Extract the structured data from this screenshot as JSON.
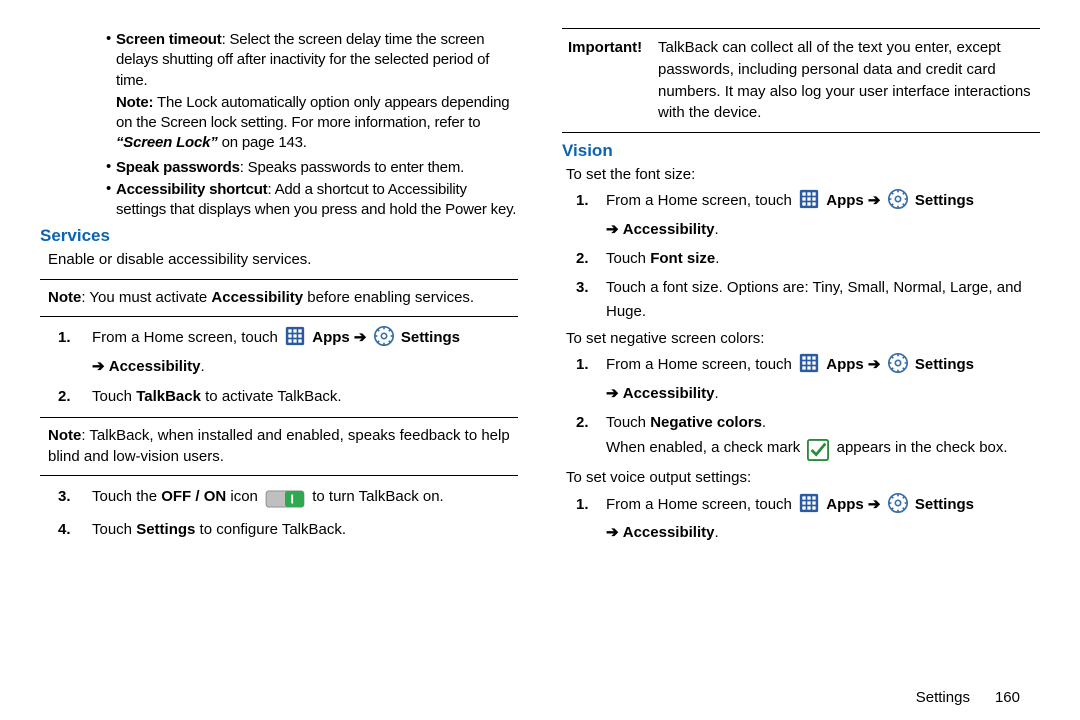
{
  "left": {
    "bullets": [
      {
        "term": "Screen timeout",
        "rest": ": Select the screen delay time the screen delays shutting off after inactivity for the selected period of time."
      },
      {
        "term": "Speak passwords",
        "rest": ": Speaks passwords to enter them."
      },
      {
        "term": "Accessibility shortcut",
        "rest": ": Add a shortcut to Accessibility settings that displays when you press and hold the Power key."
      }
    ],
    "note1_lead": "Note:",
    "note1_rest": " The Lock automatically option only appears depending on the Screen lock setting. For more information, refer to ",
    "note1_ref": "“Screen Lock”",
    "note1_tail": " on page 143.",
    "services_heading": "Services",
    "services_para": "Enable or disable accessibility services.",
    "services_note_lead": "Note",
    "services_note_rest": ": You must activate ",
    "services_note_bold": "Accessibility",
    "services_note_tail": " before enabling services.",
    "step1_pre": "From a Home screen, touch ",
    "apps_label": "Apps",
    "arrow": "➔",
    "settings_label": "Settings",
    "accessibility_label": "Accessibility",
    "step2_pre": "Touch ",
    "step2_bold": "TalkBack",
    "step2_post": " to activate TalkBack.",
    "tb_note_lead": "Note",
    "tb_note_rest": ": TalkBack, when installed and enabled, speaks feedback to help blind and low-vision users.",
    "step3_pre": "Touch the ",
    "step3_bold": "OFF / ON",
    "step3_mid": " icon ",
    "step3_post": " to turn TalkBack on.",
    "step4_pre": "Touch ",
    "step4_bold": "Settings",
    "step4_post": " to configure TalkBack."
  },
  "right": {
    "important_lead": "Important!",
    "important_rest": " TalkBack can collect all of the text you enter, except passwords, including personal data and credit card numbers. It may also log your user interface interactions with the device.",
    "vision_heading": "Vision",
    "font_intro": "To set the font size:",
    "step1_pre": "From a Home screen, touch ",
    "apps_label": "Apps",
    "arrow": "➔",
    "settings_label": "Settings",
    "accessibility_label": "Accessibility",
    "font_step2_pre": "Touch ",
    "font_step2_bold": "Font size",
    "font_step3": "Touch a font size. Options are: Tiny, Small, Normal, Large, and Huge.",
    "neg_intro": "To set negative screen colors:",
    "neg_step2_pre": "Touch ",
    "neg_step2_bold": "Negative colors",
    "neg_when_pre": "When enabled, a check mark ",
    "neg_when_post": " appears in the check box.",
    "voice_intro": "To set voice output settings:"
  },
  "footer": {
    "section": "Settings",
    "page": "160"
  }
}
